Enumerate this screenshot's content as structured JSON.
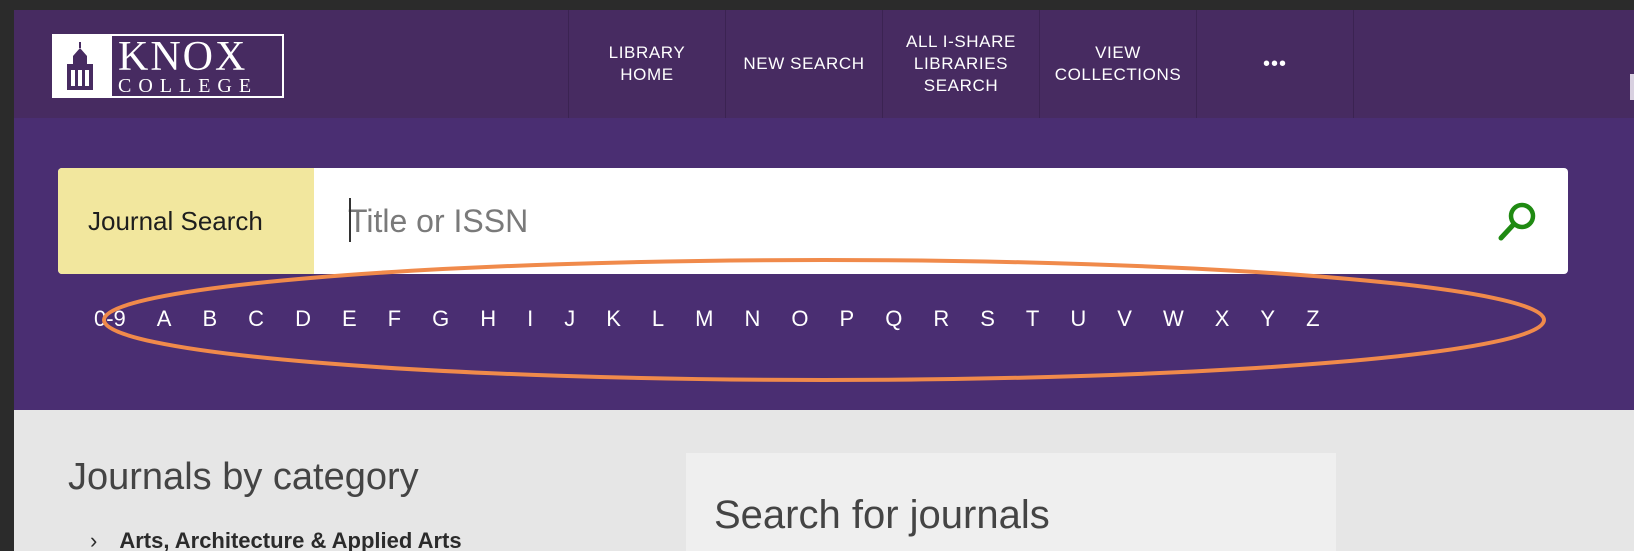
{
  "logo": {
    "line1": "KNOX",
    "line2": "COLLEGE",
    "icon": "tower-icon"
  },
  "nav": {
    "items": [
      {
        "label_lines": [
          "LIBRARY",
          "HOME"
        ]
      },
      {
        "label_lines": [
          "NEW SEARCH"
        ]
      },
      {
        "label_lines": [
          "ALL I-SHARE",
          "LIBRARIES",
          "SEARCH"
        ]
      },
      {
        "label_lines": [
          "VIEW",
          "COLLECTIONS"
        ]
      }
    ],
    "more_label": "•••"
  },
  "search": {
    "label": "Journal Search",
    "placeholder": "Title or ISSN",
    "button_icon": "search-icon",
    "accent_color": "#1f8a12"
  },
  "alphabet": [
    "0-9",
    "A",
    "B",
    "C",
    "D",
    "E",
    "F",
    "G",
    "H",
    "I",
    "J",
    "K",
    "L",
    "M",
    "N",
    "O",
    "P",
    "Q",
    "R",
    "S",
    "T",
    "U",
    "V",
    "W",
    "X",
    "Y",
    "Z"
  ],
  "annotation": {
    "shape": "oval",
    "color": "#f08a4b"
  },
  "categories": {
    "title": "Journals by category",
    "first_item": "Arts, Architecture & Applied Arts"
  },
  "panel": {
    "title": "Search for journals"
  },
  "colors": {
    "header": "#472b61",
    "band": "#4a2e72",
    "search_label_bg": "#f2e79e",
    "content_bg": "#e6e6e6"
  }
}
